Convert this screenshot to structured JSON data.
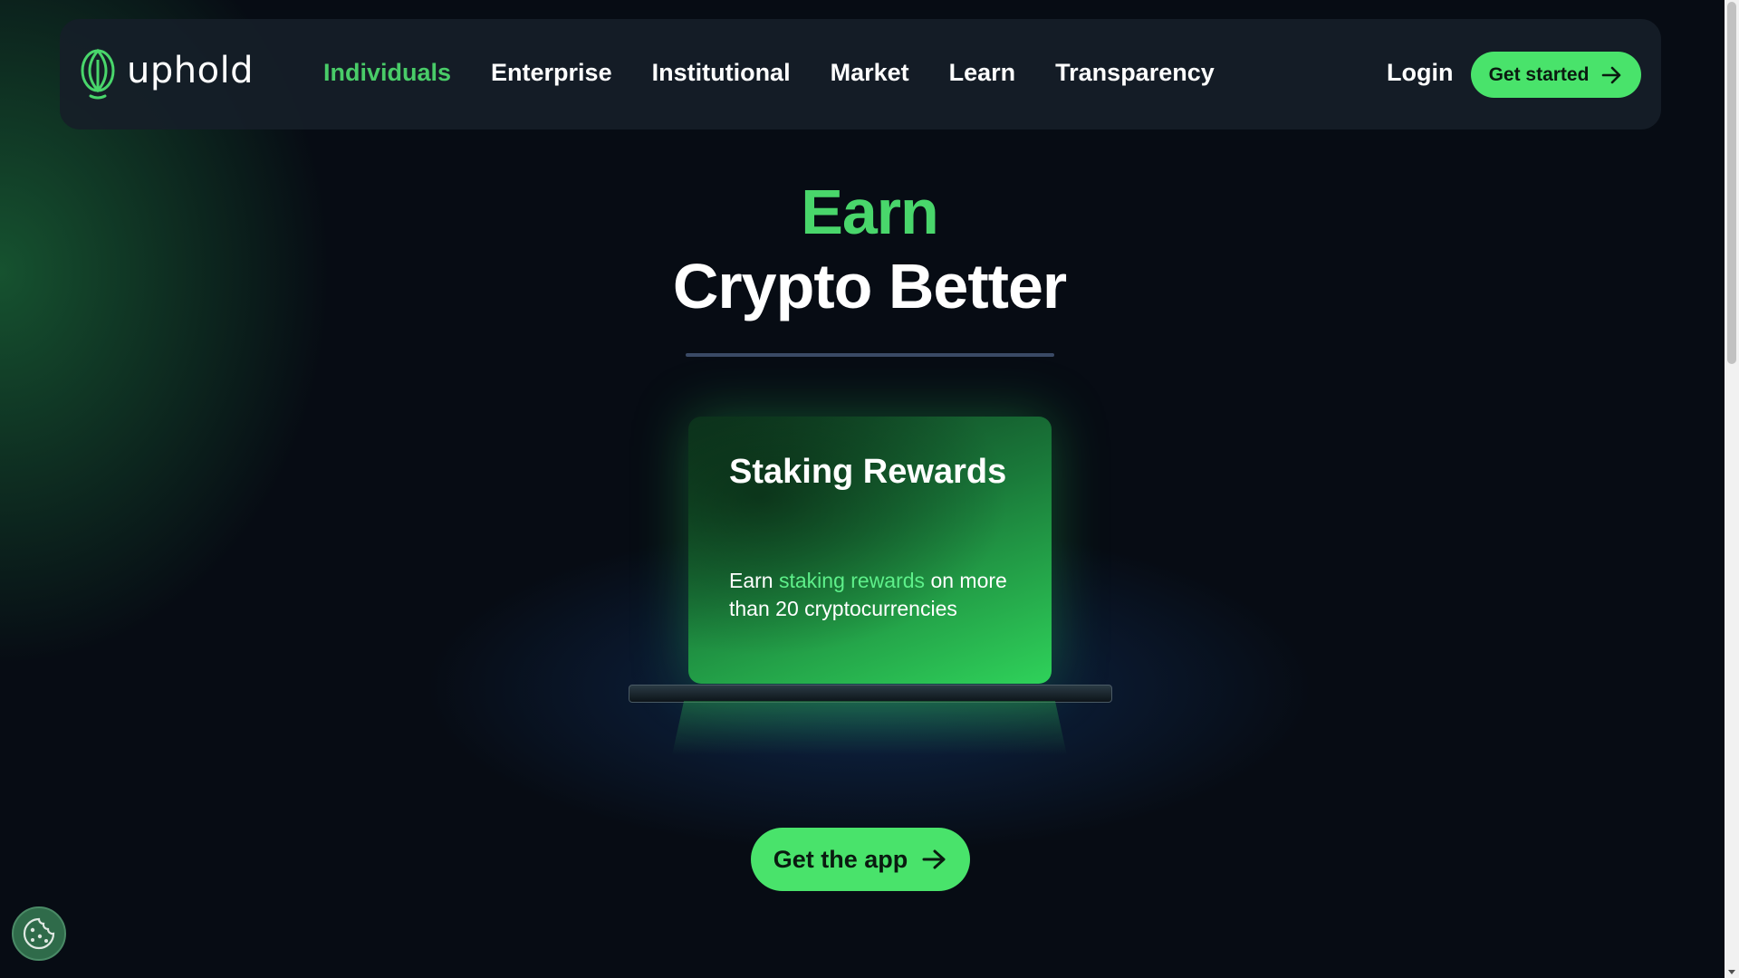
{
  "brand": {
    "name": "uphold",
    "accent_color": "#49e36b",
    "active_color": "#49cc68"
  },
  "nav": {
    "items": [
      {
        "label": "Individuals",
        "active": true
      },
      {
        "label": "Enterprise",
        "active": false
      },
      {
        "label": "Institutional",
        "active": false
      },
      {
        "label": "Market",
        "active": false
      },
      {
        "label": "Learn",
        "active": false
      },
      {
        "label": "Transparency",
        "active": false
      }
    ],
    "login_label": "Login",
    "cta_label": "Get started",
    "cta_icon": "arrow-right-icon"
  },
  "hero": {
    "headline_accent": "Earn",
    "headline_main": "Crypto Better"
  },
  "card": {
    "title": "Staking Rewards",
    "body_prefix": "Earn ",
    "body_accent": "staking rewards",
    "body_suffix": " on more than 20 cryptocurrencies"
  },
  "app_button": {
    "label": "Get the app",
    "icon": "arrow-right-icon"
  },
  "cookie_button": {
    "icon": "cookie-icon"
  }
}
